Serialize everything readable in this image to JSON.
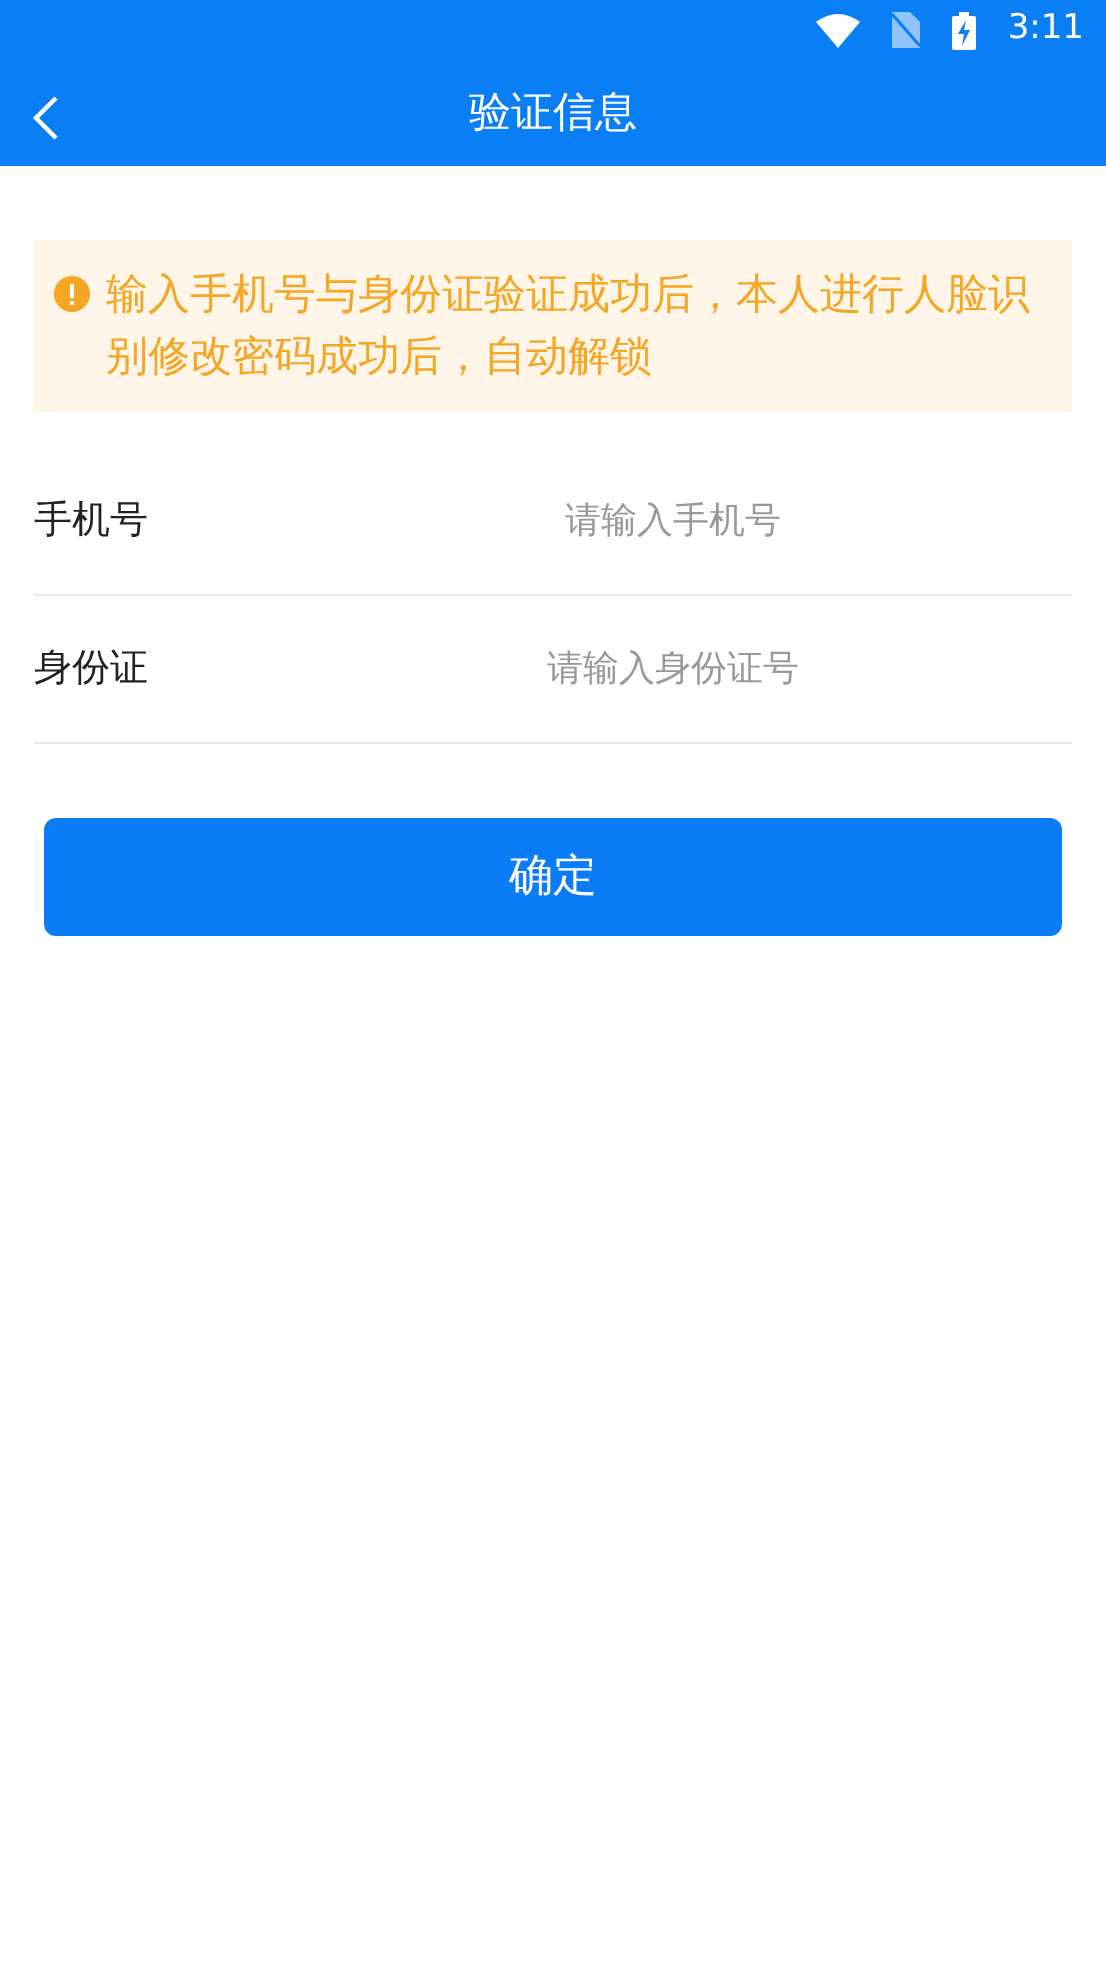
{
  "status_bar": {
    "time": "3:11"
  },
  "header": {
    "title": "验证信息"
  },
  "notice": {
    "text": "输入手机号与身份证验证成功后，本人进行人脸识别修改密码成功后，自动解锁"
  },
  "fields": [
    {
      "label": "手机号",
      "placeholder": "请输入手机号"
    },
    {
      "label": "身份证",
      "placeholder": "请输入身份证号"
    }
  ],
  "submit": {
    "label": "确定"
  }
}
